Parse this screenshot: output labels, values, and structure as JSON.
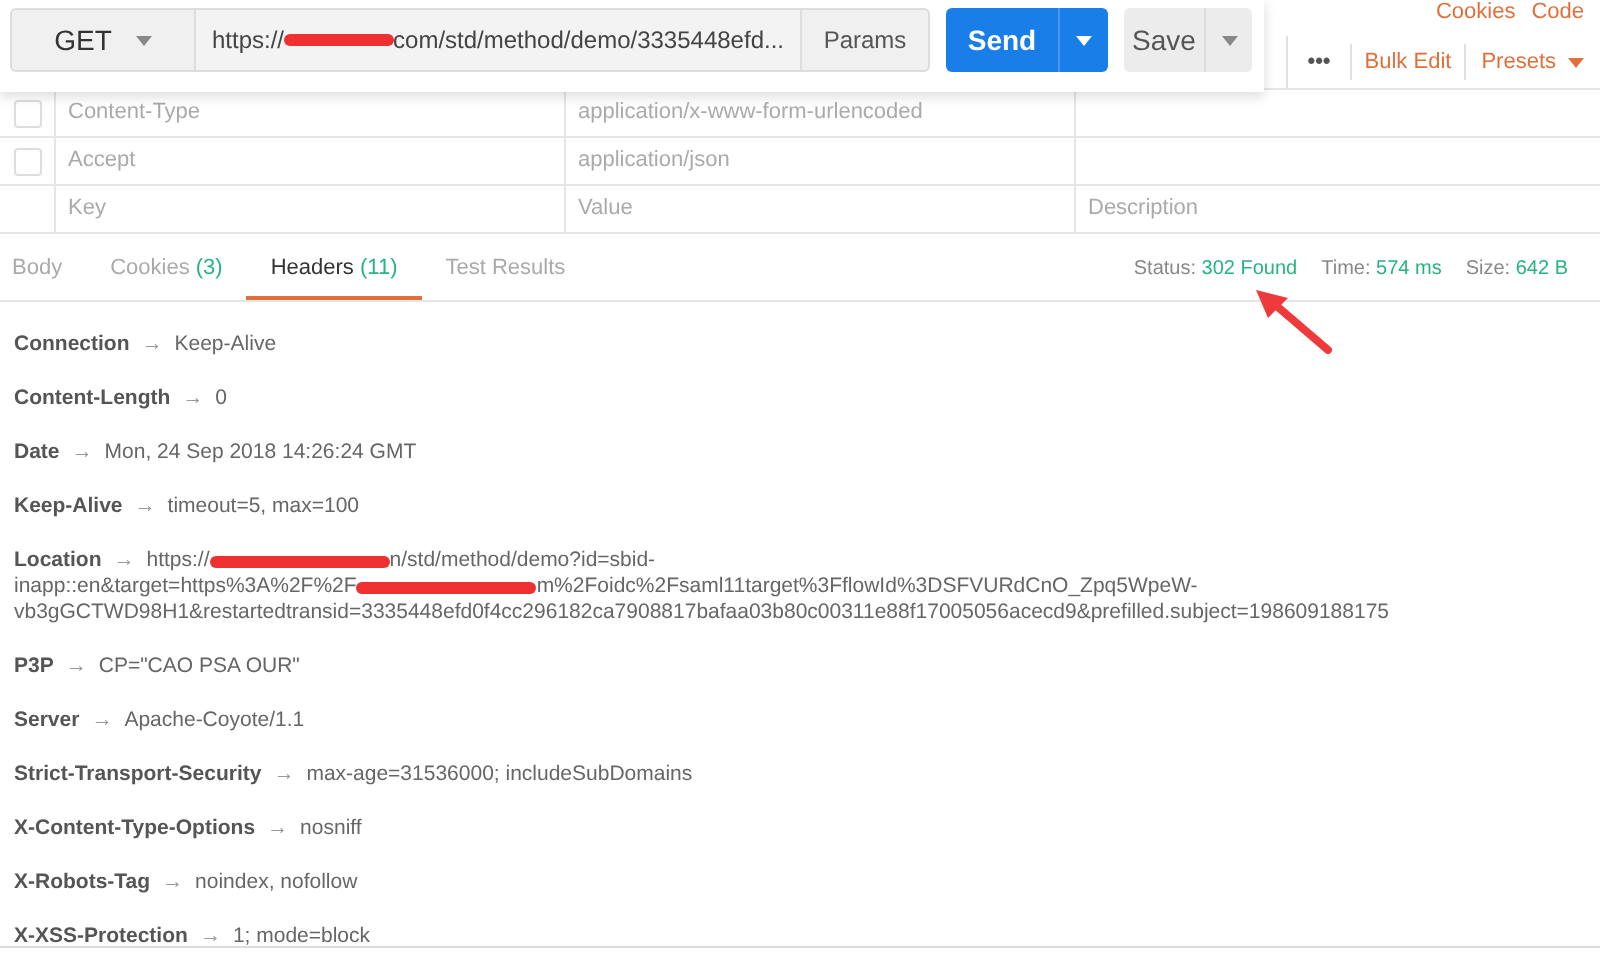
{
  "request": {
    "method": "GET",
    "url": [
      {
        "kind": "text",
        "text": "https://"
      },
      {
        "kind": "redacted"
      },
      {
        "kind": "text",
        "text": "com/std/method/demo/3335448efd..."
      }
    ],
    "params_button": "Params",
    "send_button": "Send",
    "save_button": "Save"
  },
  "top_links": [
    "Cookies",
    "Code"
  ],
  "header_tools": {
    "more": "•••",
    "bulk_edit": "Bulk Edit",
    "presets": "Presets"
  },
  "request_headers": [
    {
      "key": "Content-Type",
      "value": "application/x-www-form-urlencoded",
      "checked": false,
      "kind": "row"
    },
    {
      "key": "Accept",
      "value": "application/json",
      "checked": false,
      "kind": "row"
    },
    {
      "key": "Key",
      "value": "Value",
      "description": "Description",
      "kind": "placeholder"
    }
  ],
  "response_tabs": [
    {
      "label": "Body",
      "selected": false
    },
    {
      "label": "Cookies",
      "count": "(3)",
      "selected": false
    },
    {
      "label": "Headers",
      "count": "(11)",
      "selected": true
    },
    {
      "label": "Test Results",
      "selected": false
    }
  ],
  "status": {
    "status_label": "Status:",
    "status_value": "302 Found",
    "time_label": "Time:",
    "time_value": "574 ms",
    "size_label": "Size:",
    "size_value": "642 B"
  },
  "response_headers": [
    {
      "name": "Connection",
      "arrow": "→",
      "value": [
        [
          {
            "kind": "text",
            "text": "Keep-Alive"
          }
        ]
      ]
    },
    {
      "name": "Content-Length",
      "arrow": "→",
      "value": [
        [
          {
            "kind": "text",
            "text": "0"
          }
        ]
      ]
    },
    {
      "name": "Date",
      "arrow": "→",
      "value": [
        [
          {
            "kind": "text",
            "text": "Mon, 24 Sep 2018 14:26:24 GMT"
          }
        ]
      ]
    },
    {
      "name": "Keep-Alive",
      "arrow": "→",
      "value": [
        [
          {
            "kind": "text",
            "text": "timeout=5, max=100"
          }
        ]
      ]
    },
    {
      "name": "Location",
      "arrow": "→",
      "value": [
        [
          {
            "kind": "text",
            "text": "https://"
          },
          {
            "kind": "redacted"
          },
          {
            "kind": "text",
            "text": "n/std/method/demo?id=sbid-"
          }
        ],
        [
          {
            "kind": "text",
            "text": "inapp::en&target=https%3A%2F%2F"
          },
          {
            "kind": "redacted"
          },
          {
            "kind": "text",
            "text": "m%2Foidc%2Fsaml11target%3FflowId%3DSFVURdCnO_Zpq5WpeW-"
          }
        ],
        [
          {
            "kind": "text",
            "text": "vb3gGCTWD98H1&restartedtransid=3335448efd0f4cc296182ca7908817bafaa03b80c00311e88f17005056acecd9&prefilled.subject=198609188175"
          }
        ]
      ]
    },
    {
      "name": "P3P",
      "arrow": "→",
      "value": [
        [
          {
            "kind": "text",
            "text": "CP=\"CAO PSA OUR\""
          }
        ]
      ]
    },
    {
      "name": "Server",
      "arrow": "→",
      "value": [
        [
          {
            "kind": "text",
            "text": "Apache-Coyote/1.1"
          }
        ]
      ]
    },
    {
      "name": "Strict-Transport-Security",
      "arrow": "→",
      "value": [
        [
          {
            "kind": "text",
            "text": "max-age=31536000; includeSubDomains"
          }
        ]
      ]
    },
    {
      "name": "X-Content-Type-Options",
      "arrow": "→",
      "value": [
        [
          {
            "kind": "text",
            "text": "nosniff"
          }
        ]
      ]
    },
    {
      "name": "X-Robots-Tag",
      "arrow": "→",
      "value": [
        [
          {
            "kind": "text",
            "text": "noindex, nofollow"
          }
        ]
      ]
    },
    {
      "name": "X-XSS-Protection",
      "arrow": "→",
      "value": [
        [
          {
            "kind": "text",
            "text": "1; mode=block"
          }
        ]
      ]
    }
  ]
}
